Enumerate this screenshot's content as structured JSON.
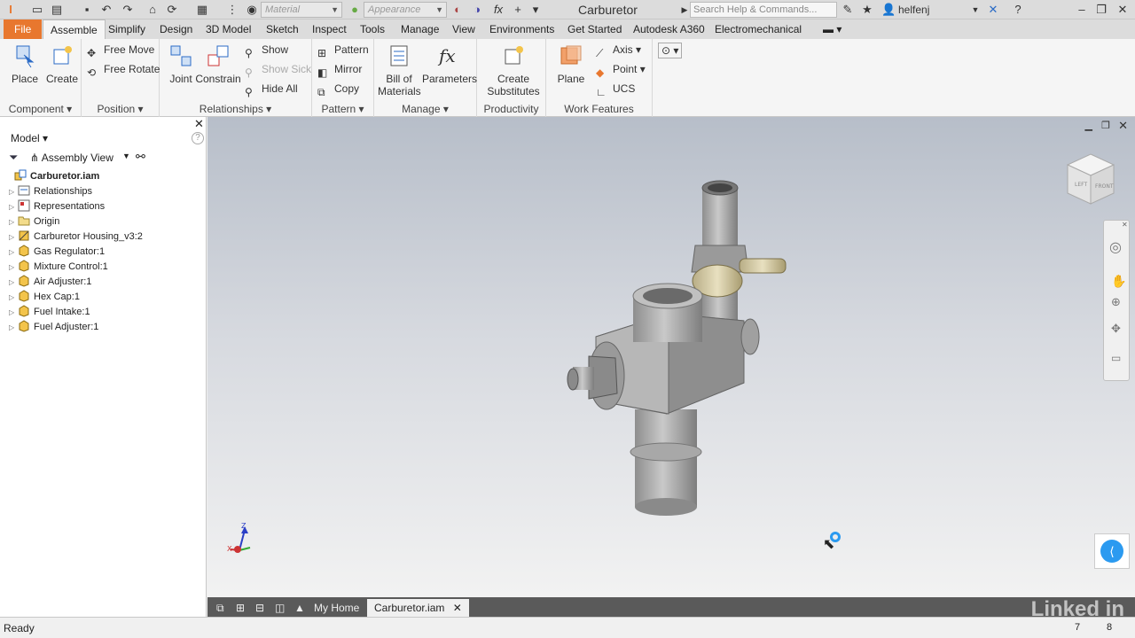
{
  "titlebar": {
    "app_name": "Carburetor",
    "material_placeholder": "Material",
    "appearance_placeholder": "Appearance",
    "search_placeholder": "Search Help & Commands...",
    "user": "helfenj"
  },
  "tabs": [
    "File",
    "Assemble",
    "Simplify",
    "Design",
    "3D Model",
    "Sketch",
    "Inspect",
    "Tools",
    "Manage",
    "View",
    "Environments",
    "Get Started",
    "Autodesk A360",
    "Electromechanical"
  ],
  "ribbon": {
    "component": {
      "label": "Component",
      "place": "Place",
      "create": "Create"
    },
    "position": {
      "label": "Position",
      "free_move": "Free Move",
      "free_rotate": "Free Rotate"
    },
    "relationships": {
      "label": "Relationships",
      "joint": "Joint",
      "constrain": "Constrain",
      "show": "Show",
      "show_sick": "Show Sick",
      "hide_all": "Hide All"
    },
    "pattern": {
      "label": "Pattern",
      "pattern": "Pattern",
      "mirror": "Mirror",
      "copy": "Copy"
    },
    "manage": {
      "label": "Manage",
      "bom_1": "Bill of",
      "bom_2": "Materials",
      "parameters": "Parameters"
    },
    "productivity": {
      "label": "Productivity",
      "create_sub_1": "Create",
      "create_sub_2": "Substitutes"
    },
    "work_features": {
      "label": "Work Features",
      "plane": "Plane",
      "axis": "Axis",
      "point": "Point",
      "ucs": "UCS"
    }
  },
  "browser": {
    "title": "Model",
    "view": "Assembly View",
    "root": "Carburetor.iam",
    "items": [
      {
        "label": "Relationships",
        "icon": "relationships-icon"
      },
      {
        "label": "Representations",
        "icon": "representations-icon"
      },
      {
        "label": "Origin",
        "icon": "folder-icon"
      },
      {
        "label": "Carburetor Housing_v3:2",
        "icon": "grounded-part-icon"
      },
      {
        "label": "Gas Regulator:1",
        "icon": "part-icon"
      },
      {
        "label": "Mixture Control:1",
        "icon": "part-icon"
      },
      {
        "label": "Air Adjuster:1",
        "icon": "part-icon"
      },
      {
        "label": "Hex Cap:1",
        "icon": "part-icon"
      },
      {
        "label": "Fuel Intake:1",
        "icon": "part-icon"
      },
      {
        "label": "Fuel Adjuster:1",
        "icon": "part-icon"
      }
    ]
  },
  "doc_tabs": {
    "home": "My Home",
    "current": "Carburetor.iam"
  },
  "status": {
    "text": "Ready",
    "num1": "7",
    "num2": "8"
  },
  "viewcube": {
    "top": "LEFT",
    "front": "FRONT"
  },
  "watermark": "Linked in",
  "colors": {
    "file_tab": "#e8772e",
    "accent": "#2b7bd6"
  }
}
